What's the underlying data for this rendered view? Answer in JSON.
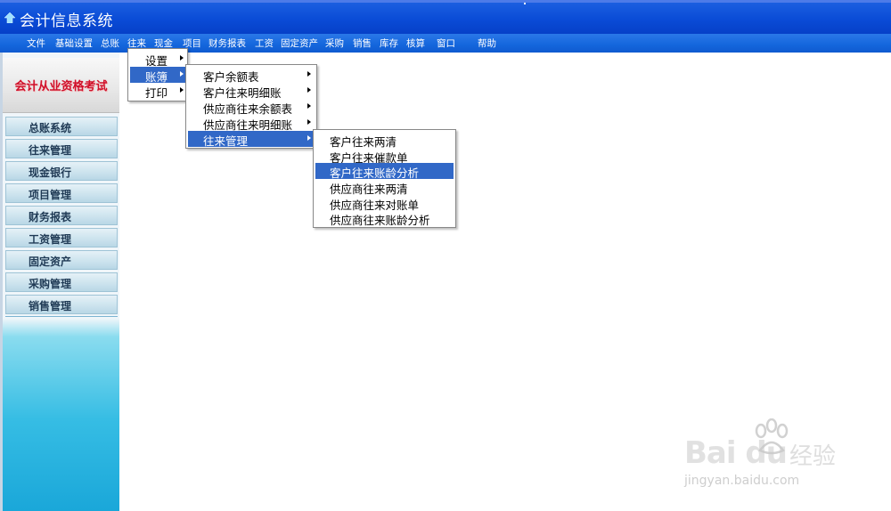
{
  "window": {
    "title": "会计信息系统"
  },
  "menubar": {
    "items": [
      {
        "label": "文件"
      },
      {
        "label": "基础设置"
      },
      {
        "label": "总账"
      },
      {
        "label": "往来"
      },
      {
        "label": "现金"
      },
      {
        "label": "项目"
      },
      {
        "label": "财务报表"
      },
      {
        "label": "工资"
      },
      {
        "label": "固定资产"
      },
      {
        "label": "采购"
      },
      {
        "label": "销售"
      },
      {
        "label": "库存"
      },
      {
        "label": "核算"
      },
      {
        "label": "窗口"
      },
      {
        "label": "帮助"
      }
    ],
    "active": "往来"
  },
  "sidebar": {
    "logo_text": "会计从业资格考试",
    "items": [
      {
        "label": "总账系统"
      },
      {
        "label": "往来管理"
      },
      {
        "label": "现金银行"
      },
      {
        "label": "项目管理"
      },
      {
        "label": "财务报表"
      },
      {
        "label": "工资管理"
      },
      {
        "label": "固定资产"
      },
      {
        "label": "采购管理"
      },
      {
        "label": "销售管理"
      }
    ]
  },
  "menu_level1": {
    "items": [
      {
        "label": "设置",
        "has_submenu": true,
        "selected": false
      },
      {
        "label": "账簿",
        "has_submenu": true,
        "selected": true
      },
      {
        "label": "打印",
        "has_submenu": true,
        "selected": false
      }
    ]
  },
  "menu_level2": {
    "items": [
      {
        "label": "客户余额表",
        "has_submenu": true,
        "selected": false
      },
      {
        "label": "客户往来明细账",
        "has_submenu": true,
        "selected": false
      },
      {
        "label": "供应商往来余额表",
        "has_submenu": true,
        "selected": false
      },
      {
        "label": "供应商往来明细账",
        "has_submenu": true,
        "selected": false
      },
      {
        "label": "往来管理",
        "has_submenu": true,
        "selected": true
      }
    ]
  },
  "menu_level3": {
    "items": [
      {
        "label": "客户往来两清",
        "selected": false
      },
      {
        "label": "客户往来催款单",
        "selected": false
      },
      {
        "label": "客户往来账龄分析",
        "selected": true
      },
      {
        "label": "供应商往来两清",
        "selected": false
      },
      {
        "label": "供应商往来对账单",
        "selected": false
      },
      {
        "label": "供应商往来账龄分析",
        "selected": false
      }
    ]
  },
  "watermark": {
    "brand": "Bai du",
    "brand_cn": "经验",
    "url": "jingyan.baidu.com"
  },
  "colors": {
    "titlebar": "#0a4bd6",
    "menubar": "#1466dc",
    "selection": "#3168c7",
    "logo_red": "#d0102a"
  }
}
